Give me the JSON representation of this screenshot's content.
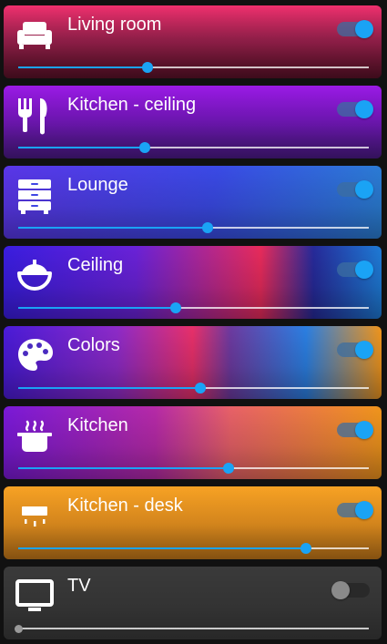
{
  "devices": [
    {
      "name": "Living room",
      "icon": "sofa-icon",
      "on": true,
      "brightness": 0.37,
      "background": "linear-gradient(to bottom, #f0306e 0%, #a22251 45%, #5a1128 100%)"
    },
    {
      "name": "Kitchen - ceiling",
      "icon": "fork-knife-icon",
      "on": true,
      "brightness": 0.36,
      "background": "linear-gradient(to bottom, #9b1ae6 0%, #7b18c6 45%, #4b1a87 100%)"
    },
    {
      "name": "Lounge",
      "icon": "dresser-icon",
      "on": true,
      "brightness": 0.54,
      "background": "linear-gradient(100deg, #5a36e8 0%, #3a4ae6 55%, #2a7fd4 100%)"
    },
    {
      "name": "Ceiling",
      "icon": "ceiling-light-icon",
      "on": true,
      "brightness": 0.45,
      "background": "linear-gradient(90deg, #3a1de0 0%, #6a22d8 35%, #e82b5b 68%, #262a9a 82%, #1e7bd6 100%)"
    },
    {
      "name": "Colors",
      "icon": "palette-icon",
      "on": true,
      "brightness": 0.52,
      "background": "linear-gradient(90deg, #4a1bd8 0%, #8e2bc9 30%, #e8306a 50%, #6d3aa0 60%, #2b7fe2 80%, #f0951c 100%)"
    },
    {
      "name": "Kitchen",
      "icon": "pot-steam-icon",
      "on": true,
      "brightness": 0.6,
      "background": "linear-gradient(90deg, #7a19d8 0%, #b62aa8 40%, #e86168 60%, #f0951c 100%)"
    },
    {
      "name": "Kitchen - desk",
      "icon": "desk-lamp-icon",
      "on": true,
      "brightness": 0.82,
      "background": "linear-gradient(to bottom, #f7a224 0%, #ee9620 50%, #c37819 100%)"
    },
    {
      "name": "TV",
      "icon": "tv-icon",
      "on": false,
      "brightness": 0,
      "background": "#3a3a3a"
    }
  ]
}
